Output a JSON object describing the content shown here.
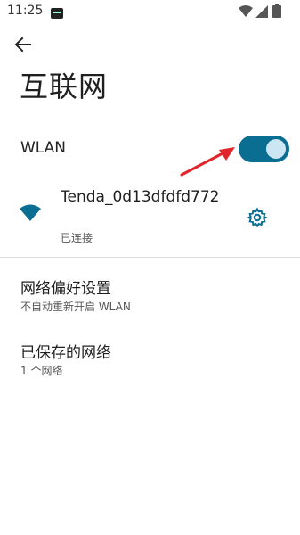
{
  "status_bar": {
    "time": "11:25"
  },
  "page": {
    "title": "互联网"
  },
  "wlan": {
    "label": "WLAN",
    "enabled": true
  },
  "network": {
    "name": "Tenda_0d13dfdfd772",
    "status": "已连接"
  },
  "preferences": [
    {
      "title": "网络偏好设置",
      "subtitle": "不自动重新开启 WLAN"
    },
    {
      "title": "已保存的网络",
      "subtitle": "1 个网络"
    }
  ],
  "colors": {
    "accent": "#0a6e93",
    "annotation": "#e0262b"
  }
}
